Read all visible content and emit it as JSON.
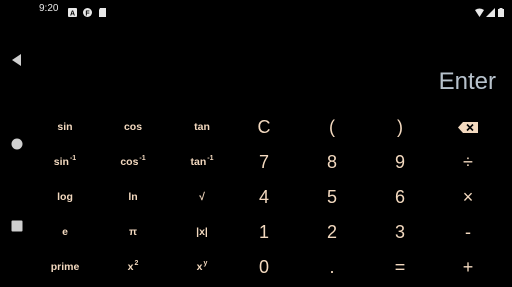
{
  "status_bar": {
    "time": "9:20",
    "left_icons": [
      "app-a-icon",
      "app-f-icon",
      "sd-card-icon"
    ],
    "right_icons": [
      "wifi-icon",
      "signal-icon",
      "battery-icon"
    ]
  },
  "nav_bar": {
    "buttons": [
      "back-icon",
      "home-icon",
      "recents-icon"
    ]
  },
  "display": {
    "text": "Enter"
  },
  "keypad": {
    "rows": [
      [
        {
          "name": "sin-key",
          "label": "sin",
          "sup": ""
        },
        {
          "name": "cos-key",
          "label": "cos",
          "sup": ""
        },
        {
          "name": "tan-key",
          "label": "tan",
          "sup": ""
        },
        {
          "name": "clear-key",
          "label": "C",
          "sup": ""
        },
        {
          "name": "open-paren-key",
          "label": "(",
          "sup": ""
        },
        {
          "name": "close-paren-key",
          "label": ")",
          "sup": ""
        },
        {
          "name": "backspace-key",
          "label": "",
          "sup": "",
          "icon": "backspace-icon"
        }
      ],
      [
        {
          "name": "asin-key",
          "label": "sin",
          "sup": "-1"
        },
        {
          "name": "acos-key",
          "label": "cos",
          "sup": "-1"
        },
        {
          "name": "atan-key",
          "label": "tan",
          "sup": "-1"
        },
        {
          "name": "digit-7-key",
          "label": "7",
          "sup": ""
        },
        {
          "name": "digit-8-key",
          "label": "8",
          "sup": ""
        },
        {
          "name": "digit-9-key",
          "label": "9",
          "sup": ""
        },
        {
          "name": "divide-key",
          "label": "÷",
          "sup": ""
        }
      ],
      [
        {
          "name": "log-key",
          "label": "log",
          "sup": ""
        },
        {
          "name": "ln-key",
          "label": "ln",
          "sup": ""
        },
        {
          "name": "sqrt-key",
          "label": "√",
          "sup": ""
        },
        {
          "name": "digit-4-key",
          "label": "4",
          "sup": ""
        },
        {
          "name": "digit-5-key",
          "label": "5",
          "sup": ""
        },
        {
          "name": "digit-6-key",
          "label": "6",
          "sup": ""
        },
        {
          "name": "multiply-key",
          "label": "×",
          "sup": ""
        }
      ],
      [
        {
          "name": "e-key",
          "label": "e",
          "sup": ""
        },
        {
          "name": "pi-key",
          "label": "π",
          "sup": ""
        },
        {
          "name": "abs-key",
          "label": "|x|",
          "sup": ""
        },
        {
          "name": "digit-1-key",
          "label": "1",
          "sup": ""
        },
        {
          "name": "digit-2-key",
          "label": "2",
          "sup": ""
        },
        {
          "name": "digit-3-key",
          "label": "3",
          "sup": ""
        },
        {
          "name": "subtract-key",
          "label": "-",
          "sup": ""
        }
      ],
      [
        {
          "name": "prime-key",
          "label": "prime",
          "sup": ""
        },
        {
          "name": "square-key",
          "label": "x",
          "sup": "2"
        },
        {
          "name": "power-key",
          "label": "x",
          "sup": "y"
        },
        {
          "name": "digit-0-key",
          "label": "0",
          "sup": ""
        },
        {
          "name": "decimal-key",
          "label": ".",
          "sup": ""
        },
        {
          "name": "equals-key",
          "label": "=",
          "sup": ""
        },
        {
          "name": "add-key",
          "label": "+",
          "sup": ""
        }
      ]
    ]
  }
}
